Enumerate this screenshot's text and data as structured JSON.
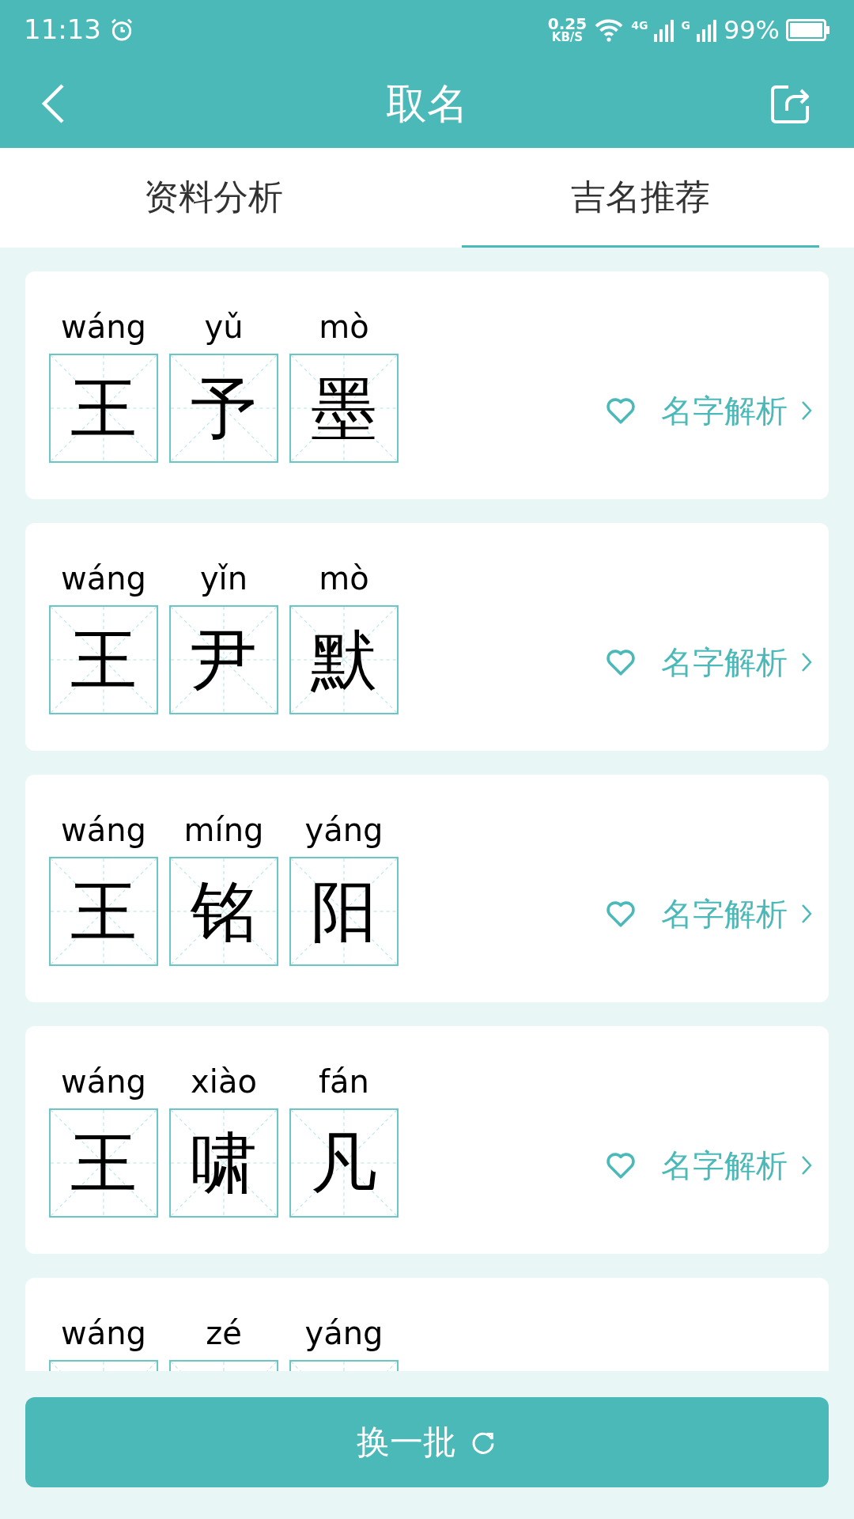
{
  "status_bar": {
    "time": "11:13",
    "speed_value": "0.25",
    "speed_unit": "KB/S",
    "network_1": "4G",
    "network_2": "G",
    "battery": "99%"
  },
  "header": {
    "title": "取名"
  },
  "tabs": [
    {
      "label": "资料分析",
      "selected": false
    },
    {
      "label": "吉名推荐",
      "selected": true
    }
  ],
  "names": [
    {
      "pinyin": [
        "wáng",
        "yǔ",
        "mò"
      ],
      "characters": [
        "王",
        "予",
        "墨"
      ],
      "favorited": false,
      "analysis_link": "名字解析"
    },
    {
      "pinyin": [
        "wáng",
        "yǐn",
        "mò"
      ],
      "characters": [
        "王",
        "尹",
        "默"
      ],
      "favorited": false,
      "analysis_link": "名字解析"
    },
    {
      "pinyin": [
        "wáng",
        "míng",
        "yáng"
      ],
      "characters": [
        "王",
        "铭",
        "阳"
      ],
      "favorited": false,
      "analysis_link": "名字解析"
    },
    {
      "pinyin": [
        "wáng",
        "xiào",
        "fán"
      ],
      "characters": [
        "王",
        "啸",
        "凡"
      ],
      "favorited": false,
      "analysis_link": "名字解析"
    },
    {
      "pinyin": [
        "wáng",
        "zé",
        "yáng"
      ]
    }
  ],
  "refresh_button": {
    "label": "换一批"
  }
}
